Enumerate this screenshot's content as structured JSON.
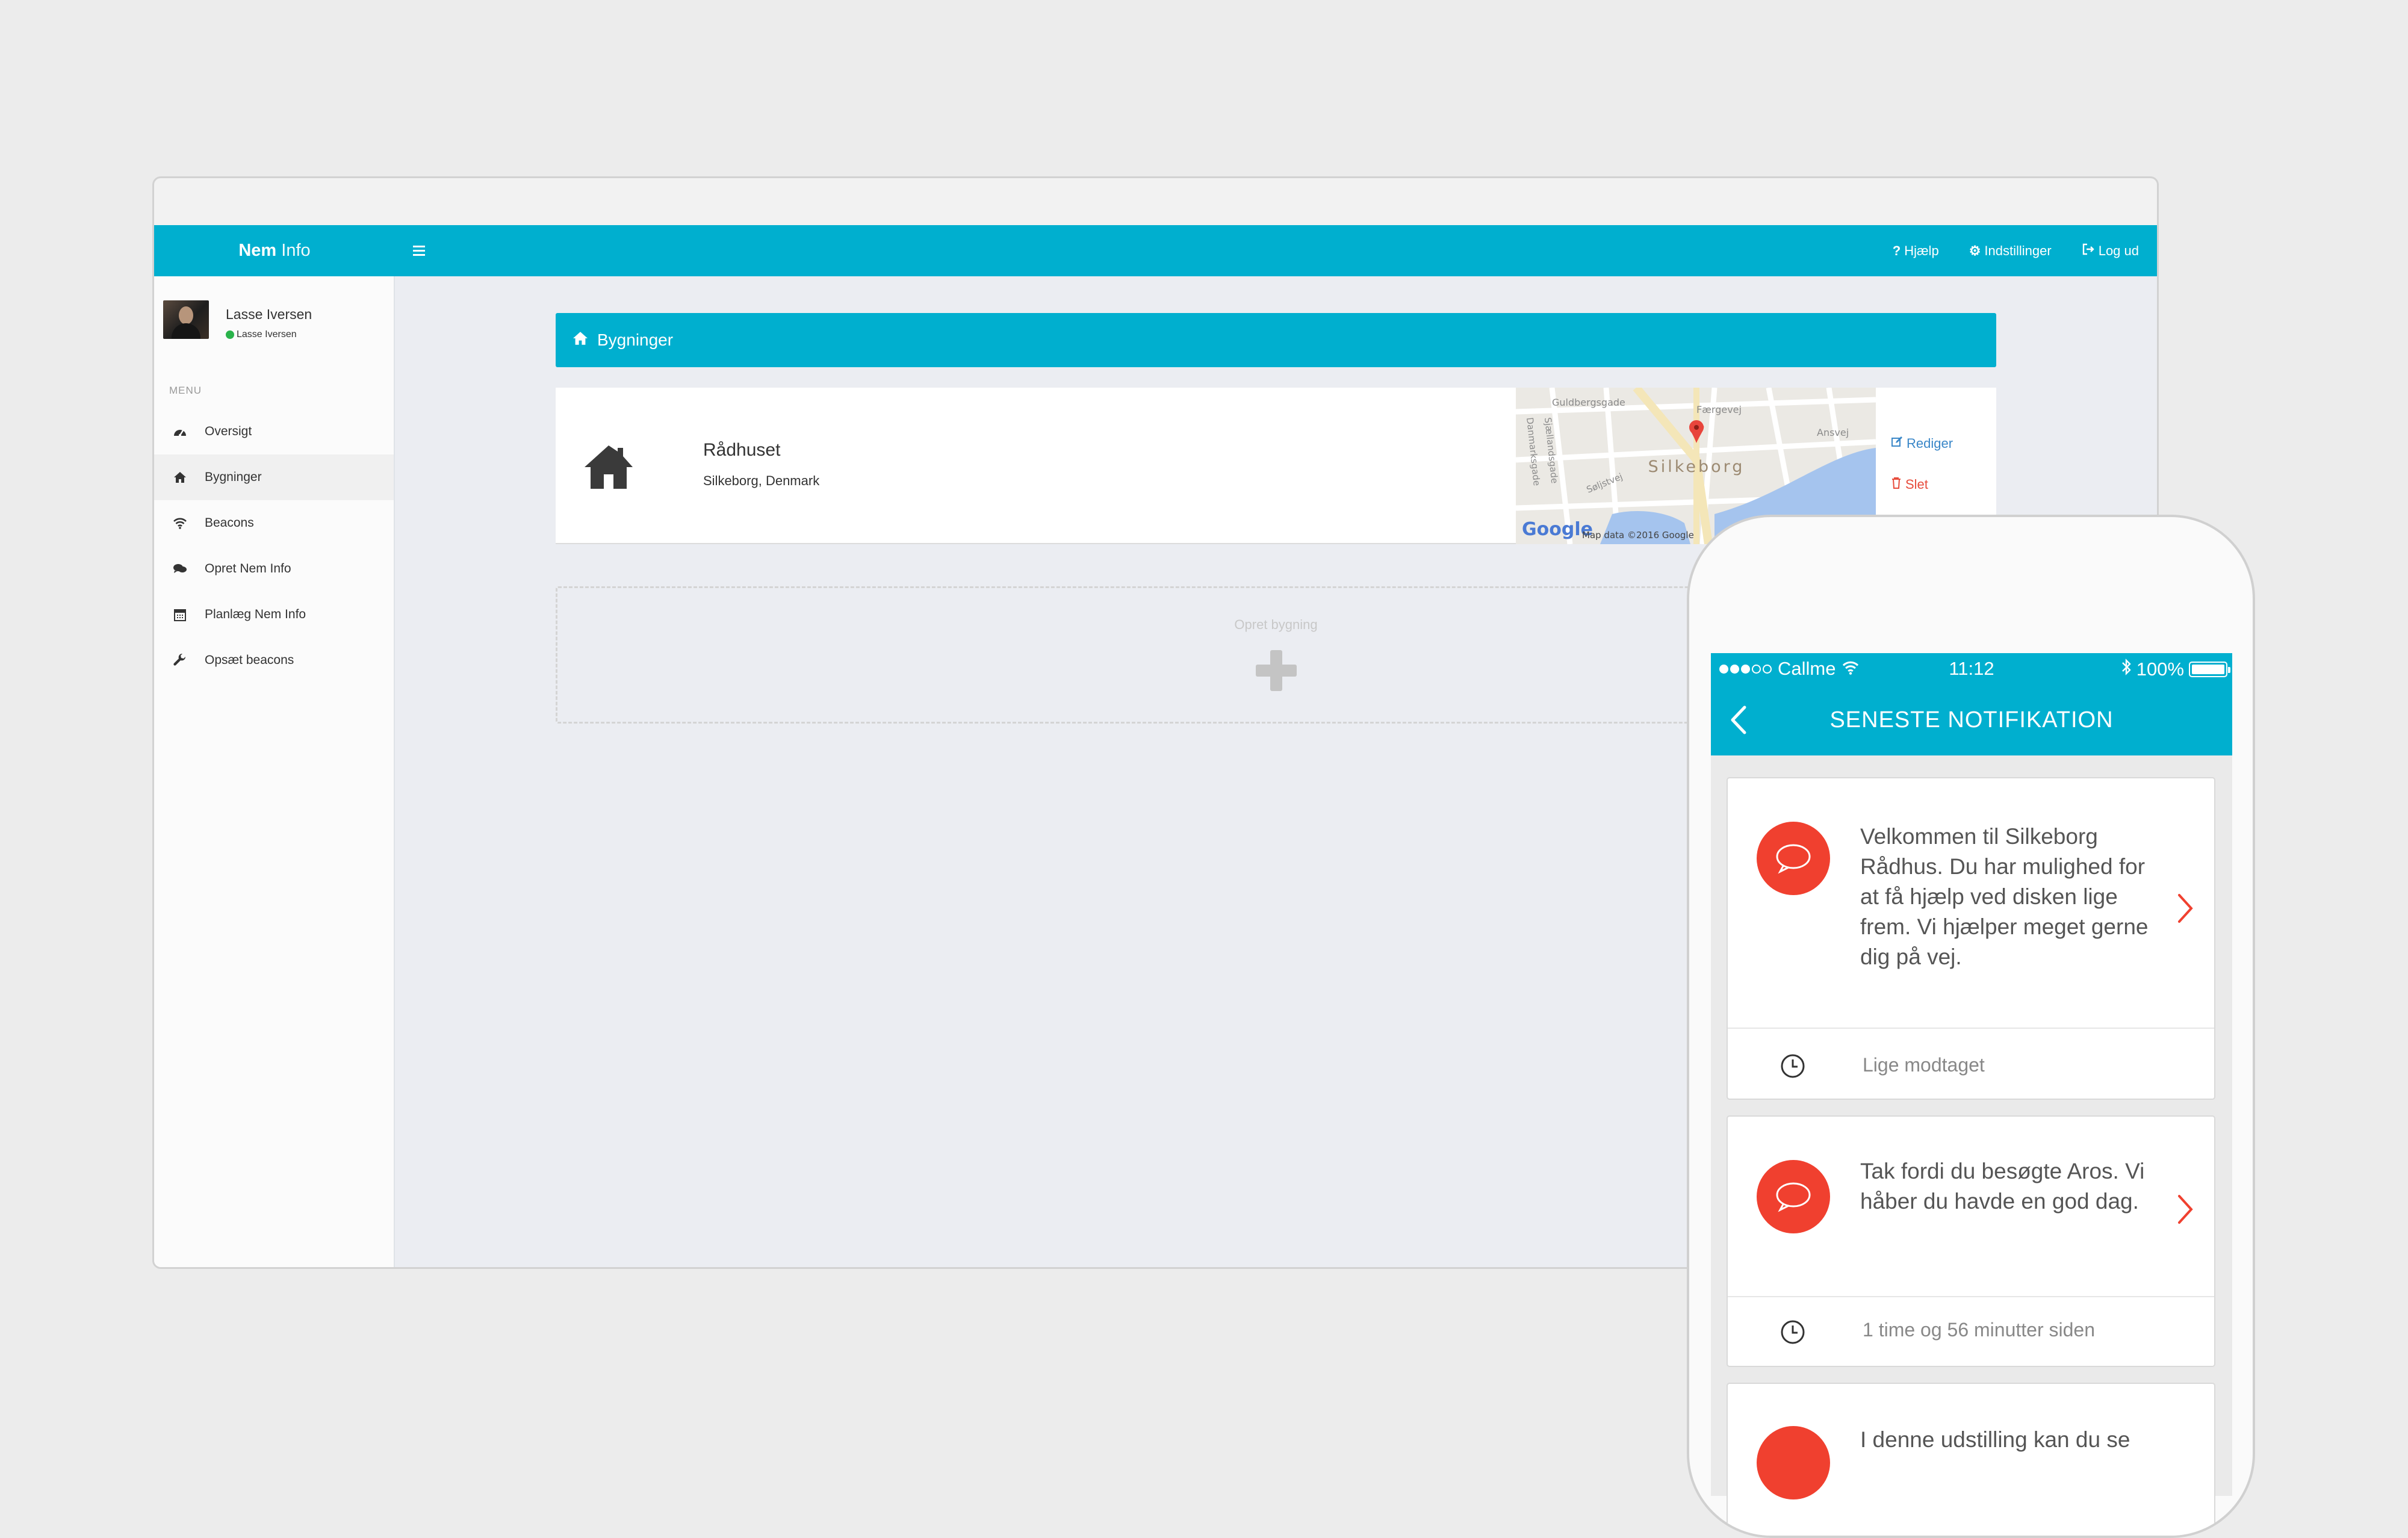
{
  "app": {
    "brand_bold": "Nem",
    "brand_light": "Info",
    "topnav": [
      {
        "icon": "question-icon",
        "label": "Hjælp"
      },
      {
        "icon": "gear-icon",
        "label": "Indstillinger"
      },
      {
        "icon": "logout-icon",
        "label": "Log ud"
      }
    ]
  },
  "sidebar": {
    "user_name": "Lasse Iversen",
    "user_status": "Lasse Iversen",
    "menu_title": "MENU",
    "items": [
      {
        "icon": "dashboard-icon",
        "label": "Oversigt"
      },
      {
        "icon": "home-icon",
        "label": "Bygninger"
      },
      {
        "icon": "wifi-icon",
        "label": "Beacons"
      },
      {
        "icon": "comments-icon",
        "label": "Opret Nem Info"
      },
      {
        "icon": "calendar-icon",
        "label": "Planlæg Nem Info"
      },
      {
        "icon": "wrench-icon",
        "label": "Opsæt beacons"
      }
    ],
    "active_index": 1
  },
  "main": {
    "panel_title": "Bygninger",
    "building": {
      "name": "Rådhuset",
      "address": "Silkeborg, Denmark",
      "map": {
        "city_label": "Silkeborg",
        "streets": [
          "Guldbergsgade",
          "Færgevej",
          "Ansvej",
          "Sjællandsgade",
          "Danmarksgade",
          "Søljstvej"
        ],
        "google_label": "Google",
        "attribution": "Map data ©2016 Google"
      },
      "edit_label": "Rediger",
      "delete_label": "Slet"
    },
    "create_label": "Opret bygning"
  },
  "phone": {
    "carrier": "Callme",
    "time": "11:12",
    "battery": "100%",
    "title": "SENESTE NOTIFIKATION",
    "notifications": [
      {
        "message": "Velkommen til Silkeborg Rådhus. Du har mulighed for at få hjælp ved disken lige frem. Vi hjælper meget gerne dig på vej.",
        "time": "Lige modtaget"
      },
      {
        "message": "Tak fordi du besøgte Aros. Vi håber du havde en god dag.",
        "time": "1 time og 56 minutter siden"
      },
      {
        "message": "I denne udstilling kan du se",
        "time": ""
      }
    ]
  },
  "colors": {
    "accent": "#00afcf",
    "danger": "#e74c3c",
    "link": "#3a87c8",
    "notification": "#f0402f"
  }
}
